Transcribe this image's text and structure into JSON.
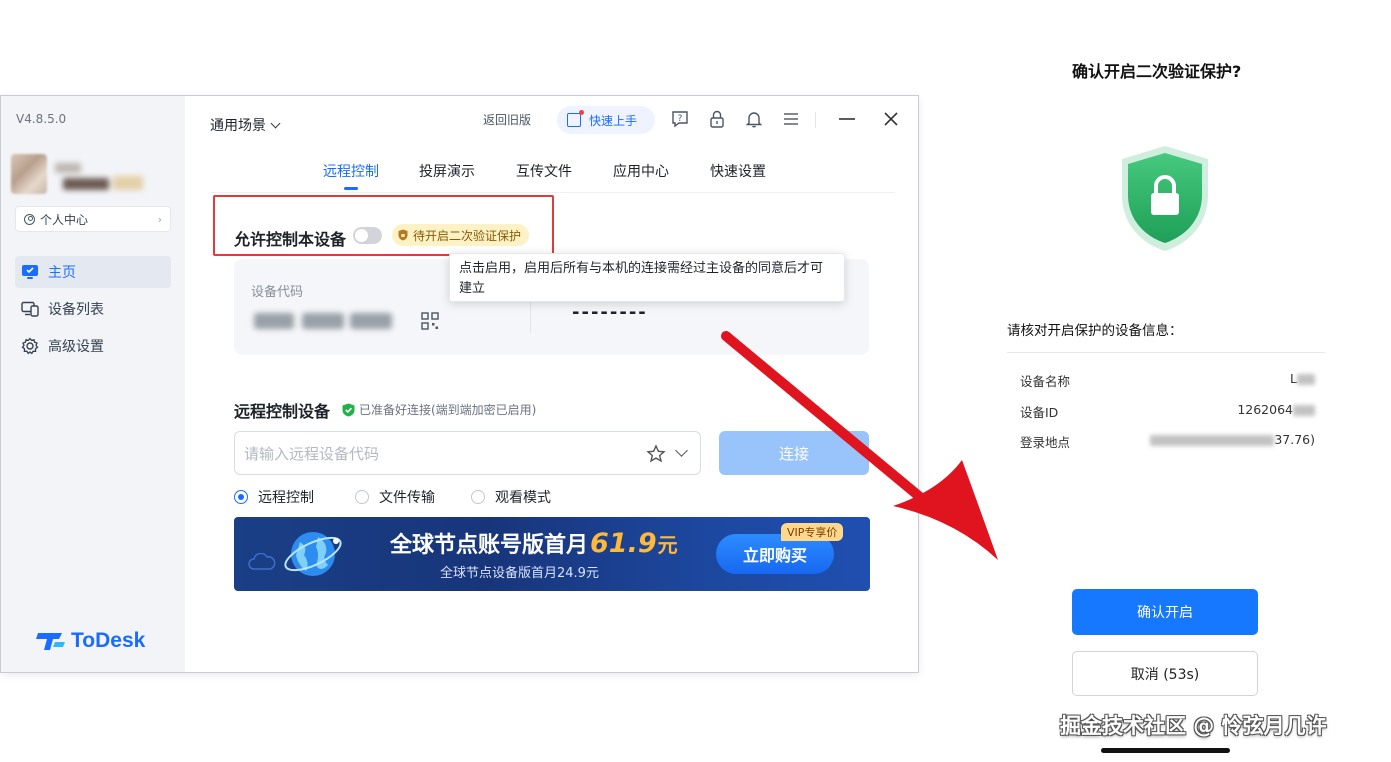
{
  "app": {
    "version": "V4.8.5.0",
    "profile_label": "个人中心",
    "brand": "ToDesk"
  },
  "sidebar": {
    "items": [
      {
        "label": "主页",
        "icon": "monitor-icon",
        "active": true
      },
      {
        "label": "设备列表",
        "icon": "devices-icon",
        "active": false
      },
      {
        "label": "高级设置",
        "icon": "gear-icon",
        "active": false
      }
    ]
  },
  "header": {
    "scene_label": "通用场景",
    "old_version_label": "返回旧版",
    "quick_start_label": "快速上手",
    "icons": [
      "help-icon",
      "lock-icon",
      "bell-icon",
      "menu-icon",
      "minimize-icon",
      "close-icon"
    ]
  },
  "tabs": [
    {
      "label": "远程控制",
      "active": true
    },
    {
      "label": "投屏演示",
      "active": false
    },
    {
      "label": "互传文件",
      "active": false
    },
    {
      "label": "应用中心",
      "active": false
    },
    {
      "label": "快速设置",
      "active": false
    }
  ],
  "allow_control": {
    "label": "允许控制本设备",
    "enabled": false,
    "badge": "待开启二次验证保护"
  },
  "tooltip": {
    "text": "点击启用，启用后所有与本机的连接需经过主设备的同意后才可建立"
  },
  "device_card": {
    "code_label": "设备代码",
    "password_value": "--------"
  },
  "remote": {
    "title": "远程控制设备",
    "ready_text": "已准备好连接(端到端加密已启用)",
    "input_placeholder": "请输入远程设备代码",
    "connect_label": "连接",
    "modes": [
      {
        "label": "远程控制",
        "selected": true
      },
      {
        "label": "文件传输",
        "selected": false
      },
      {
        "label": "观看模式",
        "selected": false
      }
    ]
  },
  "banner": {
    "headline": "全球节点账号版首月",
    "price": "61.9",
    "price_unit": "元",
    "subline": "全球节点设备版首月24.9元",
    "buy_label": "立即购买",
    "vip_tag": "VIP专享价"
  },
  "confirm_panel": {
    "title": "确认开启二次验证保护?",
    "verify_heading": "请核对开启保护的设备信息：",
    "rows": [
      {
        "key": "设备名称",
        "value": "L"
      },
      {
        "key": "设备ID",
        "value": "1262064"
      },
      {
        "key": "登录地点",
        "value": "37.76)"
      }
    ],
    "confirm_label": "确认开启",
    "cancel_label": "取消 (53s)"
  },
  "watermark": "掘金技术社区 @ 怜弦月几许",
  "colors": {
    "accent": "#1a6cff",
    "highlight_border": "#e23b3b",
    "arrow": "#e0141e",
    "shield_green": "#2fb56b",
    "badge_bg": "#fdf2c6"
  }
}
